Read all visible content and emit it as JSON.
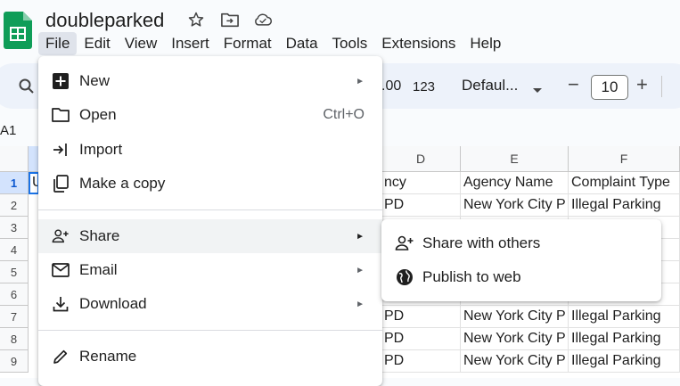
{
  "header": {
    "doc_title": "doubleparked",
    "menus": [
      "File",
      "Edit",
      "View",
      "Insert",
      "Format",
      "Data",
      "Tools",
      "Extensions",
      "Help"
    ],
    "active_menu": "File"
  },
  "toolbar": {
    "decimals_label": ".00",
    "number_format_label": "123",
    "font_family": "Defaul...",
    "minus_label": "−",
    "font_size": "10",
    "plus_label": "+"
  },
  "name_box": "A1",
  "grid": {
    "columns": [
      {
        "letter": "D"
      },
      {
        "letter": "E"
      },
      {
        "letter": "F"
      }
    ],
    "row_numbers": [
      "1",
      "2",
      "3",
      "4",
      "5",
      "6",
      "7",
      "8",
      "9"
    ],
    "a1_text": "U",
    "rows": [
      [
        "ncy",
        "Agency Name",
        "Complaint Type"
      ],
      [
        "PD",
        "New York City P",
        "Illegal Parking"
      ],
      [
        "",
        "",
        ""
      ],
      [
        "",
        "",
        ""
      ],
      [
        "",
        "",
        ""
      ],
      [
        "",
        "",
        ""
      ],
      [
        "PD",
        "New York City P",
        "Illegal Parking"
      ],
      [
        "PD",
        "New York City P",
        "Illegal Parking"
      ],
      [
        "PD",
        "New York City P",
        "Illegal Parking"
      ]
    ]
  },
  "file_menu": {
    "items": [
      {
        "label": "New",
        "arrow": "►",
        "icon": "new-sheet-icon"
      },
      {
        "label": "Open",
        "shortcut": "Ctrl+O",
        "icon": "folder-icon"
      },
      {
        "label": "Import",
        "icon": "import-icon"
      },
      {
        "label": "Make a copy",
        "icon": "copy-icon"
      },
      {
        "label": "Share",
        "arrow": "►",
        "icon": "add-person-icon"
      },
      {
        "label": "Email",
        "arrow": "►",
        "icon": "mail-icon"
      },
      {
        "label": "Download",
        "arrow": "►",
        "icon": "download-icon"
      },
      {
        "label": "Rename",
        "icon": "pencil-icon"
      }
    ]
  },
  "share_submenu": {
    "items": [
      {
        "label": "Share with others",
        "icon": "add-person-icon"
      },
      {
        "label": "Publish to web",
        "icon": "globe-icon"
      }
    ]
  },
  "colors": {
    "sheets_green": "#0f9d58",
    "selection_blue": "#1a73e8",
    "toolbar_bg": "#edf2fa"
  }
}
